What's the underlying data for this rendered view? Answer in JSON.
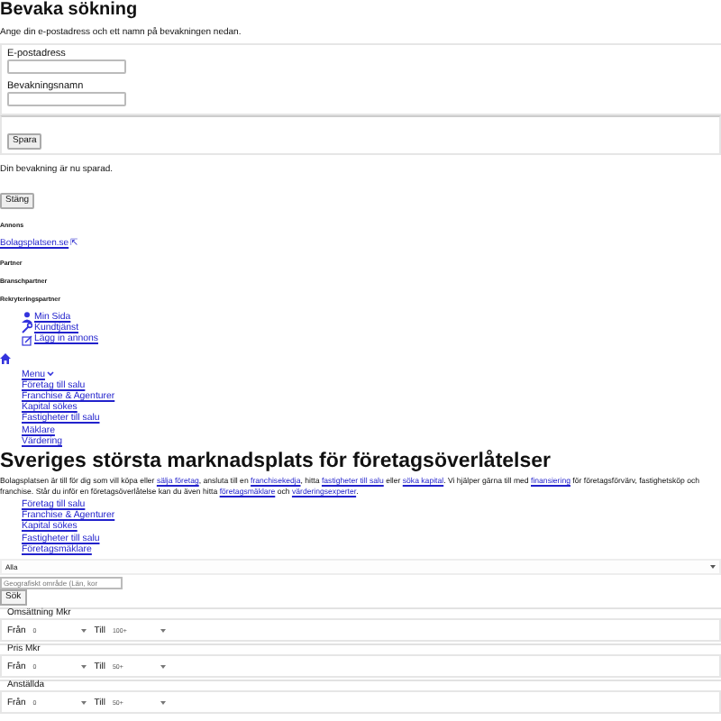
{
  "watch": {
    "title": "Bevaka sökning",
    "intro": "Ange din e-postadress och ett namn på bevakningen nedan.",
    "fields": [
      {
        "label": "E-postadress"
      },
      {
        "label": "Bevakningsnamn"
      }
    ],
    "save_button": "Spara",
    "saved_message": "Din bevakning är nu sparad.",
    "close_button": "Stäng"
  },
  "sponsors": {
    "ad_heading": "Annons",
    "ad_link": "Bolagsplatsen.se",
    "ad_link_icon": "⇱",
    "headings": [
      "Partner",
      "Branschpartner",
      "Rekryteringspartner"
    ]
  },
  "user_links": [
    {
      "label": "Min Sida",
      "kind": "user"
    },
    {
      "label": "Kundtjänst",
      "kind": "wrench"
    },
    {
      "label": "Lägg in annons",
      "kind": "add"
    }
  ],
  "menu": {
    "toggle": "Menu",
    "items": [
      "Företag till salu",
      "Franchise & Agenturer",
      "Kapital sökes",
      "Fastigheter till salu",
      "Mäklare",
      "Värdering"
    ]
  },
  "hero": {
    "title": "Sveriges största marknadsplats för företagsöverlåtelser",
    "paragraph": [
      {
        "kind": "text",
        "text": "Bolagsplatsen är till för dig som vill köpa eller "
      },
      {
        "kind": "link",
        "text": "sälja företag"
      },
      {
        "kind": "text",
        "text": ", ansluta till en "
      },
      {
        "kind": "link",
        "text": "franchisekedja"
      },
      {
        "kind": "text",
        "text": ", hitta "
      },
      {
        "kind": "link",
        "text": "fastigheter till salu"
      },
      {
        "kind": "text",
        "text": " eller "
      },
      {
        "kind": "link",
        "text": "söka kapital"
      },
      {
        "kind": "text",
        "text": ". Vi hjälper gärna till med "
      },
      {
        "kind": "link",
        "text": "finansiering"
      },
      {
        "kind": "text",
        "text": " för företagsförvärv, fastighetsköp och franchise. Står du inför en företagsöverlåtelse kan du även hitta "
      },
      {
        "kind": "link",
        "text": "företagsmäklare"
      },
      {
        "kind": "text",
        "text": " och "
      },
      {
        "kind": "link",
        "text": "värderingsexperter"
      },
      {
        "kind": "text",
        "text": "."
      }
    ],
    "links": [
      "Företag till salu",
      "Franchise & Agenturer",
      "Kapital sökes",
      "Fastigheter till salu",
      "Företagsmäklare"
    ]
  },
  "search": {
    "category": "Alla",
    "area_placeholder": "Geografiskt område (Län, kor",
    "button": "Sök",
    "ranges": [
      {
        "legend": "Omsättning Mkr",
        "from_label": "Från",
        "from": "0",
        "to_label": "Till",
        "to": "100+"
      },
      {
        "legend": "Pris Mkr",
        "from_label": "Från",
        "from": "0",
        "to_label": "Till",
        "to": "50+"
      },
      {
        "legend": "Anställda",
        "from_label": "Från",
        "from": "0",
        "to_label": "Till",
        "to": "50+"
      }
    ]
  }
}
